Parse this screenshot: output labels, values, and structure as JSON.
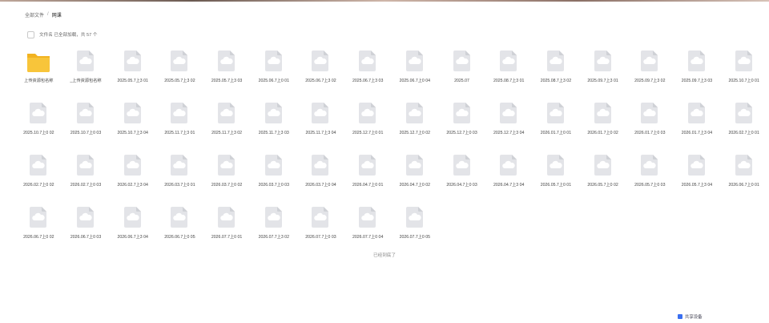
{
  "breadcrumb": {
    "root": "全部文件",
    "separator": "/",
    "current": "网课"
  },
  "selection": {
    "label": "文件名 已全部加载，共 57 个"
  },
  "footer": {
    "loaded_text": "已经到底了",
    "bottom_button": "共享设备"
  },
  "items": [
    {
      "type": "folder",
      "name": "上传资源包名称"
    },
    {
      "type": "file",
      "name": "_上传资源包名称"
    },
    {
      "type": "file",
      "name": "2025.05.7上3 01"
    },
    {
      "type": "file",
      "name": "2025.05.7上3 02"
    },
    {
      "type": "file",
      "name": "2025.05.7上3 03"
    },
    {
      "type": "file",
      "name": "2025.06.7上0 01"
    },
    {
      "type": "file",
      "name": "2025.06.7上3 02"
    },
    {
      "type": "file",
      "name": "2025.06.7上3 03"
    },
    {
      "type": "file",
      "name": "2025.06.7上0 04"
    },
    {
      "type": "file",
      "name": "2025.07"
    },
    {
      "type": "file",
      "name": "2025.08.7上3 01"
    },
    {
      "type": "file",
      "name": "2025.08.7上3 02"
    },
    {
      "type": "file",
      "name": "2025.09.7上3 01"
    },
    {
      "type": "file",
      "name": "2025.09.7上3 02"
    },
    {
      "type": "file",
      "name": "2025.09.7上3 03"
    },
    {
      "type": "file",
      "name": "2025.10.7上0 01"
    },
    {
      "type": "file",
      "name": "2025.10.7上0 02"
    },
    {
      "type": "file",
      "name": "2025.10.7上0 03"
    },
    {
      "type": "file",
      "name": "2025.10.7上3 04"
    },
    {
      "type": "file",
      "name": "2025.11.7上3 01"
    },
    {
      "type": "file",
      "name": "2025.11.7上3 02"
    },
    {
      "type": "file",
      "name": "2025.11.7上3 03"
    },
    {
      "type": "file",
      "name": "2025.11.7上3 04"
    },
    {
      "type": "file",
      "name": "2025.12.7上0 01"
    },
    {
      "type": "file",
      "name": "2025.12.7上0 02"
    },
    {
      "type": "file",
      "name": "2025.12.7上0 03"
    },
    {
      "type": "file",
      "name": "2025.12.7上3 04"
    },
    {
      "type": "file",
      "name": "2026.01.7上0 01"
    },
    {
      "type": "file",
      "name": "2026.01.7上0 02"
    },
    {
      "type": "file",
      "name": "2026.01.7上0 03"
    },
    {
      "type": "file",
      "name": "2026.01.7上3 04"
    },
    {
      "type": "file",
      "name": "2026.02.7上0 01"
    },
    {
      "type": "file",
      "name": "2026.02.7上0 02"
    },
    {
      "type": "file",
      "name": "2026.02.7上0 03"
    },
    {
      "type": "file",
      "name": "2026.02.7上3 04"
    },
    {
      "type": "file",
      "name": "2026.03.7上0 01"
    },
    {
      "type": "file",
      "name": "2026.03.7上0 02"
    },
    {
      "type": "file",
      "name": "2026.03.7上0 03"
    },
    {
      "type": "file",
      "name": "2026.03.7上0 04"
    },
    {
      "type": "file",
      "name": "2026.04.7上0 01"
    },
    {
      "type": "file",
      "name": "2026.04.7上0 02"
    },
    {
      "type": "file",
      "name": "2026.04.7上0 03"
    },
    {
      "type": "file",
      "name": "2026.04.7上3 04"
    },
    {
      "type": "file",
      "name": "2026.05.7上0 01"
    },
    {
      "type": "file",
      "name": "2026.05.7上0 02"
    },
    {
      "type": "file",
      "name": "2026.05.7上0 03"
    },
    {
      "type": "file",
      "name": "2026.05.7上3 04"
    },
    {
      "type": "file",
      "name": "2026.06.7上0 01"
    },
    {
      "type": "file",
      "name": "2026.06.7上0 02"
    },
    {
      "type": "file",
      "name": "2026.06.7上0 03"
    },
    {
      "type": "file",
      "name": "2026.06.7上3 04"
    },
    {
      "type": "file",
      "name": "2026.06.7上0 05"
    },
    {
      "type": "file",
      "name": "2026.07.7上0 01"
    },
    {
      "type": "file",
      "name": "2026.07.7上3 02"
    },
    {
      "type": "file",
      "name": "2026.07.7上0 03"
    },
    {
      "type": "file",
      "name": "2026.07.7上0 04"
    },
    {
      "type": "file",
      "name": "2026.07.7上0 05"
    }
  ]
}
